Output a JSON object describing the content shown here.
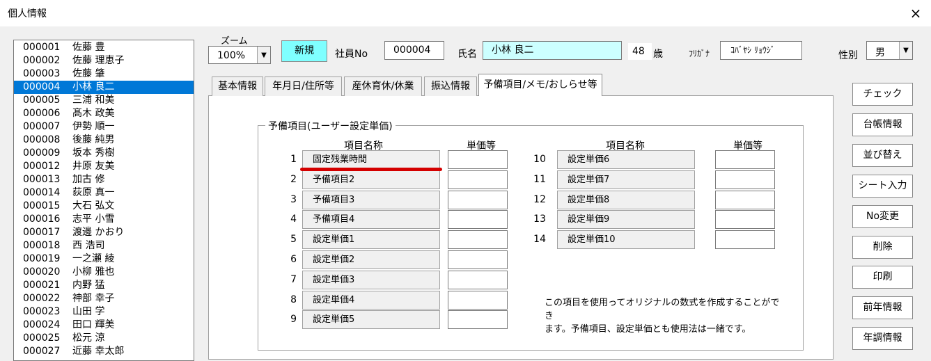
{
  "window": {
    "title": "個人情報",
    "close_icon": "×"
  },
  "employees": [
    {
      "no": "000001",
      "name": "佐藤 豊"
    },
    {
      "no": "000002",
      "name": "佐藤 理恵子"
    },
    {
      "no": "000003",
      "name": "佐藤 肇"
    },
    {
      "no": "000004",
      "name": "小林 良二"
    },
    {
      "no": "000005",
      "name": "三浦 和美"
    },
    {
      "no": "000006",
      "name": "髙木 政美"
    },
    {
      "no": "000007",
      "name": "伊勢 順一"
    },
    {
      "no": "000008",
      "name": "後藤 純男"
    },
    {
      "no": "000009",
      "name": "坂本 秀樹"
    },
    {
      "no": "000012",
      "name": "井原 友美"
    },
    {
      "no": "000013",
      "name": "加古 修"
    },
    {
      "no": "000014",
      "name": "荻原 真一"
    },
    {
      "no": "000015",
      "name": "大石 弘文"
    },
    {
      "no": "000016",
      "name": "志平 小雪"
    },
    {
      "no": "000017",
      "name": "渡邊 かおり"
    },
    {
      "no": "000018",
      "name": "西 浩司"
    },
    {
      "no": "000019",
      "name": "一之瀬 綾"
    },
    {
      "no": "000020",
      "name": "小柳 雅也"
    },
    {
      "no": "000021",
      "name": "内野 猛"
    },
    {
      "no": "000022",
      "name": "神部 幸子"
    },
    {
      "no": "000023",
      "name": "山田 学"
    },
    {
      "no": "000024",
      "name": "田口 輝美"
    },
    {
      "no": "000025",
      "name": "松元 涼"
    },
    {
      "no": "000027",
      "name": "近藤 幸太郎"
    }
  ],
  "selected_employee": "000004",
  "header": {
    "zoom_label": "ズーム",
    "zoom_value": "100%",
    "new_button": "新規",
    "empno_label": "社員No",
    "empno_value": "000004",
    "name_label": "氏名",
    "name_value": "小林 良二",
    "age_value": "48",
    "age_unit": "歳",
    "kana_label": "ﾌﾘｶﾞﾅ",
    "kana_value": "ｺﾊﾞﾔｼ ﾘｮｳｼﾞ",
    "gender_label": "性別",
    "gender_value": "男"
  },
  "tabs": [
    "基本情報",
    "年月日/住所等",
    "産休育休/休業",
    "振込情報",
    "予備項目/メモ/おしらせ等"
  ],
  "active_tab": "予備項目/メモ/おしらせ等",
  "group": {
    "title": "予備項目(ユーザー設定単価)",
    "col_name": "項目名称",
    "col_price": "単価等",
    "left_rows": [
      {
        "num": "1",
        "name": "固定残業時間"
      },
      {
        "num": "2",
        "name": "予備項目2"
      },
      {
        "num": "3",
        "name": "予備項目3"
      },
      {
        "num": "4",
        "name": "予備項目4"
      },
      {
        "num": "5",
        "name": "設定単価1"
      },
      {
        "num": "6",
        "name": "設定単価2"
      },
      {
        "num": "7",
        "name": "設定単価3"
      },
      {
        "num": "8",
        "name": "設定単価4"
      },
      {
        "num": "9",
        "name": "設定単価5"
      }
    ],
    "right_rows": [
      {
        "num": "10",
        "name": "設定単価6"
      },
      {
        "num": "11",
        "name": "設定単価7"
      },
      {
        "num": "12",
        "name": "設定単価8"
      },
      {
        "num": "13",
        "name": "設定単価9"
      },
      {
        "num": "14",
        "name": "設定単価10"
      }
    ],
    "note_line1": "この項目を使用ってオリジナルの数式を作成することができ",
    "note_line2": "ます。予備項目、設定単価とも使用法は一緒です。"
  },
  "side_buttons": [
    "チェック",
    "台帳情報",
    "並び替え",
    "シート入力",
    "No変更",
    "削除",
    "印刷",
    "前年情報",
    "年調情報"
  ],
  "colors": {
    "selection": "#0078d7",
    "new_button": "#7fffff",
    "name_field": "#ccffff",
    "annotation": "#d40000"
  }
}
